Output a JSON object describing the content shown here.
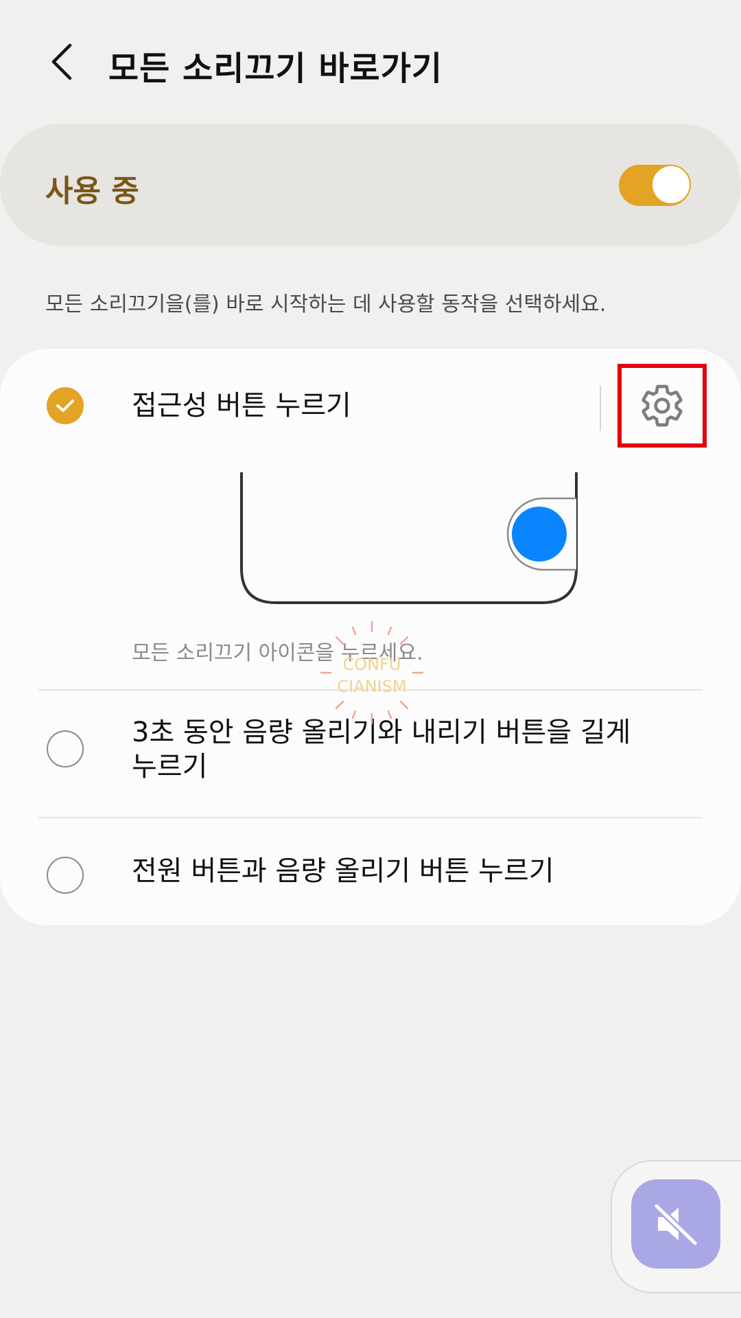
{
  "header": {
    "title": "모든 소리끄기 바로가기",
    "back_icon": "chevron-left-icon"
  },
  "master_switch": {
    "label": "사용 중",
    "state": "on",
    "accent_color": "#e3a324"
  },
  "description": "모든 소리끄기을(를) 바로 시작하는 데 사용할 동작을 선택하세요.",
  "options": [
    {
      "label": "접근성 버튼 누르기",
      "selected": true,
      "caption": "모든 소리끄기 아이콘을 누르세요.",
      "settings_icon": "gear-icon"
    },
    {
      "label_line1": "3초 동안 음량 올리기와 내리기 버튼을 길게",
      "label_line2": "누르기",
      "selected": false
    },
    {
      "label": "전원 버튼과 음량 올리기 버튼 누르기",
      "selected": false
    }
  ],
  "watermark": {
    "line1": "CONFU",
    "line2": "CIANISM"
  },
  "floating_button": {
    "icon": "mute-speaker-icon"
  }
}
